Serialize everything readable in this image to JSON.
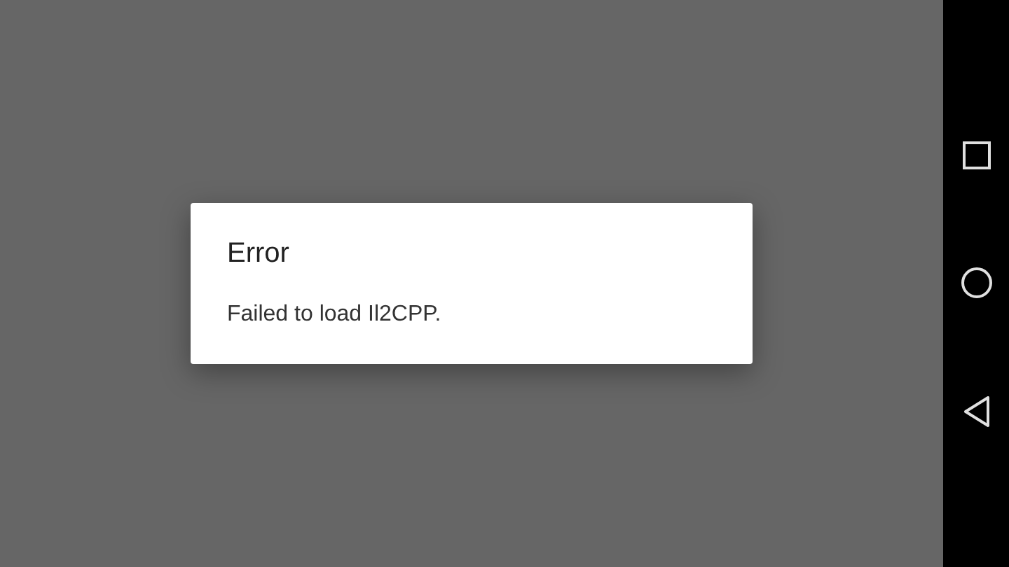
{
  "dialog": {
    "title": "Error",
    "message": "Failed to load Il2CPP."
  }
}
